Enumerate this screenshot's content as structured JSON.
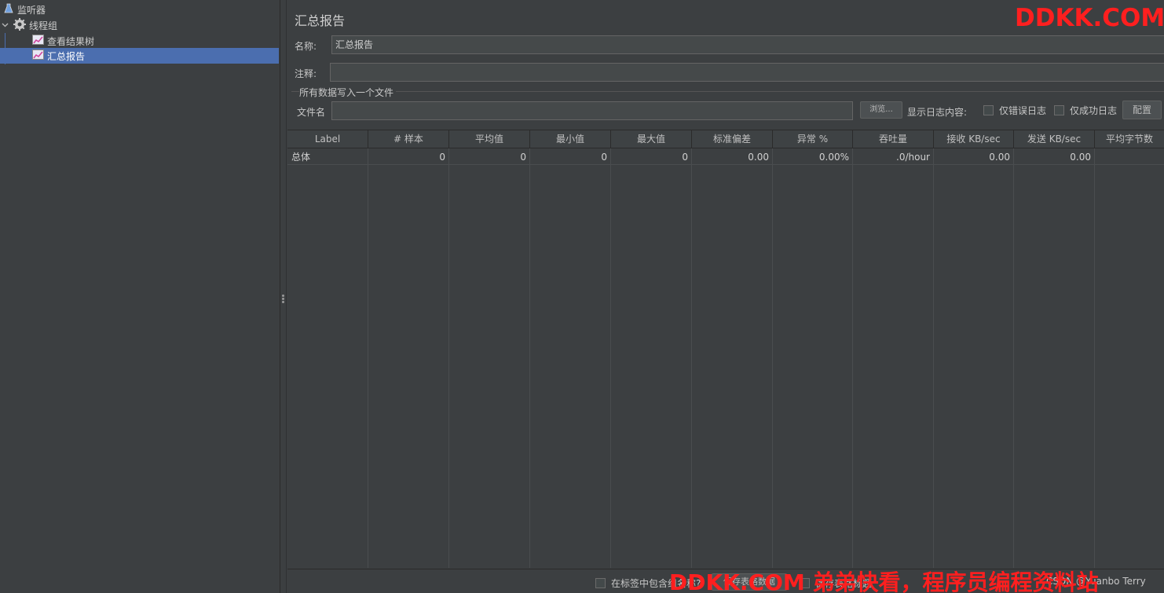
{
  "tree": {
    "items": [
      {
        "label": "监听器",
        "icon": "flask-icon"
      },
      {
        "label": "线程组",
        "icon": "gear-icon"
      },
      {
        "label": "查看结果树",
        "icon": "chart-icon"
      },
      {
        "label": "汇总报告",
        "icon": "chart-icon",
        "selected": true
      }
    ]
  },
  "panel": {
    "title": "汇总报告",
    "name_label": "名称:",
    "name_value": "汇总报告",
    "comment_label": "注释:",
    "comment_value": "",
    "group_title": "所有数据写入一个文件",
    "filename_label": "文件名",
    "filename_value": "",
    "browse_label": "浏览...",
    "log_content_label": "显示日志内容:",
    "errors_only_label": "仅错误日志",
    "success_only_label": "仅成功日志",
    "configure_label": "配置"
  },
  "table": {
    "columns": [
      "Label",
      "# 样本",
      "平均值",
      "最小值",
      "最大值",
      "标准偏差",
      "异常 %",
      "吞吐量",
      "接收 KB/sec",
      "发送 KB/sec",
      "平均字节数"
    ],
    "rows": [
      [
        "总体",
        "0",
        "0",
        "0",
        "0",
        "0.00",
        "0.00%",
        ".0/hour",
        "0.00",
        "0.00",
        ""
      ]
    ]
  },
  "bottom": {
    "include_group_label": "在标签中包含组名称?",
    "save_table_label": "保存表格数据",
    "save_header_label": "保存表格标题"
  },
  "watermark": {
    "top": "DDKK.COM",
    "bottom": "DDKK.COM 弟弟快看，程序员编程资料站",
    "credit": "CSDN @Yuanbo Terry"
  },
  "colors": {
    "background": "#3c3f41",
    "selection": "#4b6eaf",
    "watermark": "#ff1f1f"
  }
}
